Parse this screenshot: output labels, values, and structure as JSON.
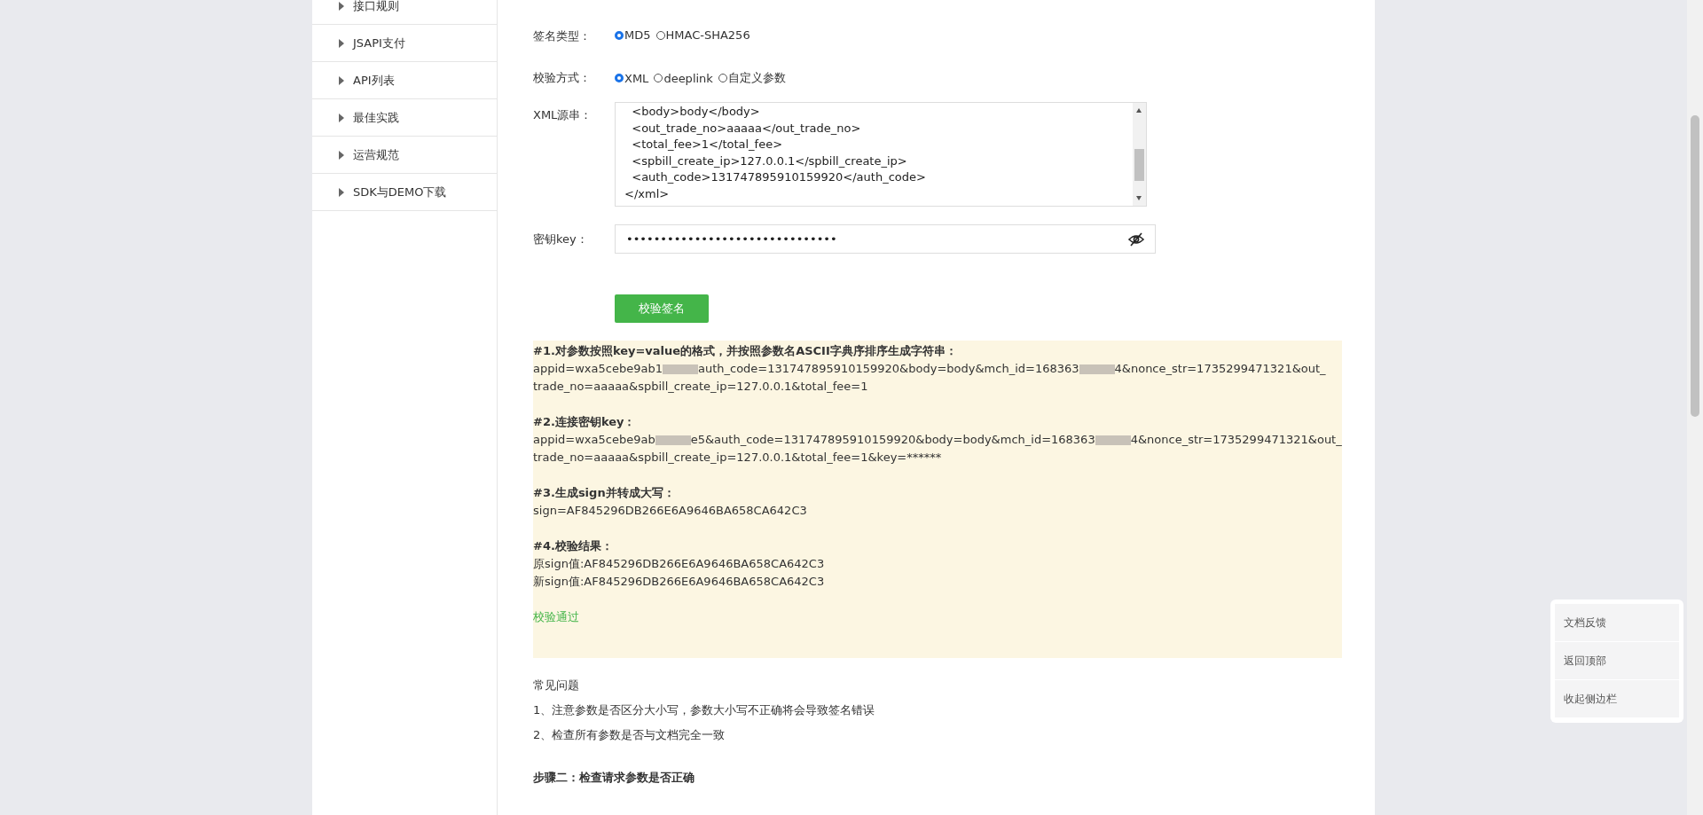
{
  "sidebar": {
    "items": [
      {
        "label": "接口规则"
      },
      {
        "label": "JSAPI支付"
      },
      {
        "label": "API列表"
      },
      {
        "label": "最佳实践"
      },
      {
        "label": "运营规范"
      },
      {
        "label": "SDK与DEMO下载"
      }
    ]
  },
  "form": {
    "sign_type": {
      "label": "签名类型：",
      "options": [
        {
          "label": "MD5",
          "selected": true
        },
        {
          "label": "HMAC-SHA256",
          "selected": false
        }
      ]
    },
    "verify_method": {
      "label": "校验方式：",
      "options": [
        {
          "label": "XML",
          "selected": true
        },
        {
          "label": "deeplink",
          "selected": false
        },
        {
          "label": "自定义参数",
          "selected": false
        }
      ]
    },
    "xml_source": {
      "label": "XML源串：",
      "lines": [
        "  <body>body</body>",
        "  <out_trade_no>aaaaa</out_trade_no>",
        "  <total_fee>1</total_fee>",
        "  <spbill_create_ip>127.0.0.1</spbill_create_ip>",
        "  <auth_code>131747895910159920</auth_code>",
        "</xml>"
      ]
    },
    "key": {
      "label": "密钥key：",
      "value": "•••••••••••••••••••••••••••••••"
    },
    "submit": "校验签名"
  },
  "result": {
    "steps": [
      {
        "title": "#1.对参数按照key=value的格式，并按照参数名ASCII字典序排序生成字符串：",
        "lines": [
          [
            {
              "kind": "text",
              "text": "appid=wxa5cebe9ab1"
            },
            {
              "kind": "redacted"
            },
            {
              "kind": "text",
              "text": "auth_code=131747895910159920&body=body&mch_id=168363"
            },
            {
              "kind": "redacted"
            },
            {
              "kind": "text",
              "text": "4&nonce_str=1735299471321&out_"
            }
          ],
          [
            {
              "kind": "text",
              "text": "trade_no=aaaaa&spbill_create_ip=127.0.0.1&total_fee=1"
            }
          ]
        ]
      },
      {
        "title": "#2.连接密钥key：",
        "lines": [
          [
            {
              "kind": "text",
              "text": "appid=wxa5cebe9ab"
            },
            {
              "kind": "redacted"
            },
            {
              "kind": "text",
              "text": "e5&auth_code=131747895910159920&body=body&mch_id=168363"
            },
            {
              "kind": "redacted"
            },
            {
              "kind": "text",
              "text": "4&nonce_str=1735299471321&out_"
            }
          ],
          [
            {
              "kind": "text",
              "text": "trade_no=aaaaa&spbill_create_ip=127.0.0.1&total_fee=1&key=******"
            }
          ]
        ]
      },
      {
        "title": "#3.生成sign并转成大写：",
        "lines": [
          [
            {
              "kind": "text",
              "text": "sign=AF845296DB266E6A9646BA658CA642C3"
            }
          ]
        ]
      },
      {
        "title": "#4.校验结果：",
        "lines": [
          [
            {
              "kind": "text",
              "text": "原sign值:AF845296DB266E6A9646BA658CA642C3"
            }
          ],
          [
            {
              "kind": "text",
              "text": "新sign值:AF845296DB266E6A9646BA658CA642C3"
            }
          ]
        ]
      }
    ],
    "status": "校验通过",
    "passed": true
  },
  "faq": {
    "title": "常见问题",
    "items": [
      "1、注意参数是否区分大小写，参数大小写不正确将会导致签名错误",
      "2、检查所有参数是否与文档完全一致"
    ]
  },
  "next_step": "步骤二：检查请求参数是否正确",
  "float_panel": [
    "文档反馈",
    "返回顶部",
    "收起侧边栏"
  ]
}
